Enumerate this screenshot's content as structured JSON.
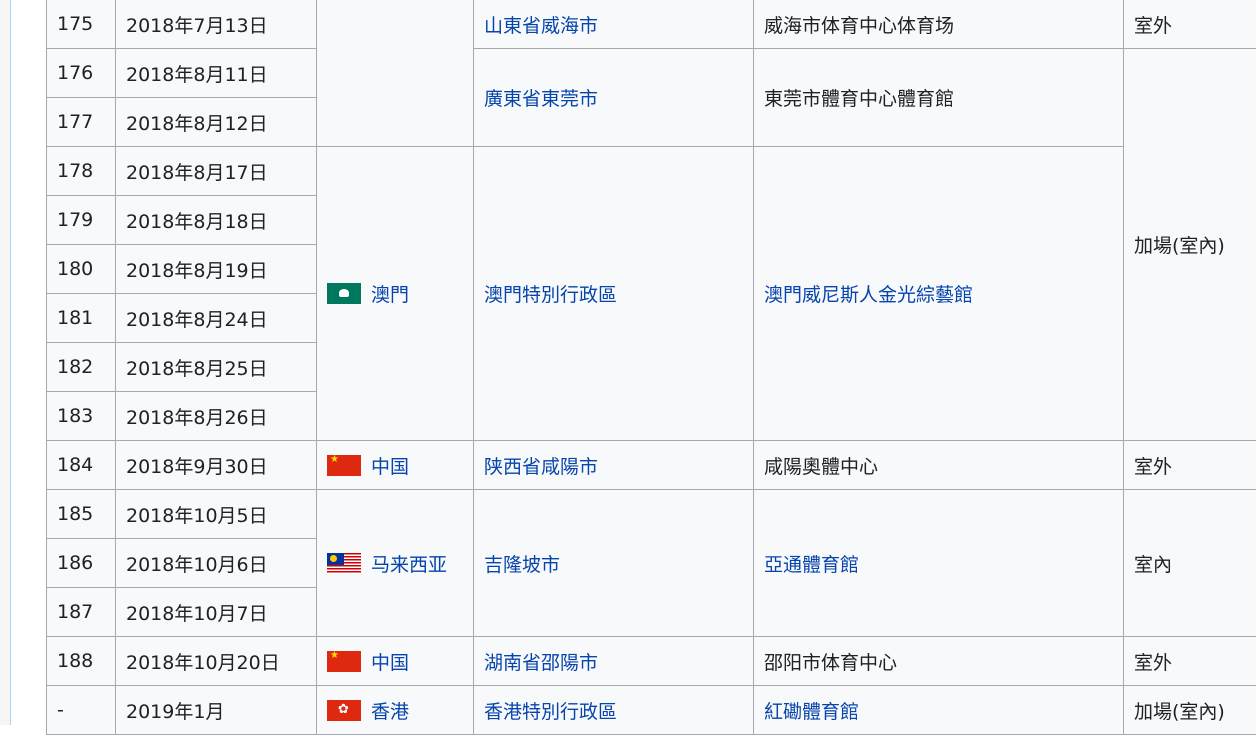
{
  "rows": [
    {
      "num": "175",
      "date": "2018年7月13日",
      "region": "",
      "city": "山東省威海市",
      "venue": "威海市体育中心体育场",
      "type": "室外"
    },
    {
      "num": "176",
      "date": "2018年8月11日",
      "region": "",
      "city": "廣東省東莞市",
      "venue": "東莞市體育中心體育館",
      "type": "加場(室內)"
    },
    {
      "num": "177",
      "date": "2018年8月12日"
    },
    {
      "num": "178",
      "date": "2018年8月17日",
      "region": "澳門",
      "city": "澳門特別行政區",
      "venue": "澳門威尼斯人金光綜藝館"
    },
    {
      "num": "179",
      "date": "2018年8月18日"
    },
    {
      "num": "180",
      "date": "2018年8月19日"
    },
    {
      "num": "181",
      "date": "2018年8月24日"
    },
    {
      "num": "182",
      "date": "2018年8月25日"
    },
    {
      "num": "183",
      "date": "2018年8月26日"
    },
    {
      "num": "184",
      "date": "2018年9月30日",
      "region": "中国",
      "city": "陕西省咸陽市",
      "venue": "咸陽奧體中心",
      "type": "室外"
    },
    {
      "num": "185",
      "date": "2018年10月5日",
      "region": "马来西亚",
      "city": "吉隆坡市",
      "venue": "亞通體育館",
      "type": "室內"
    },
    {
      "num": "186",
      "date": "2018年10月6日"
    },
    {
      "num": "187",
      "date": "2018年10月7日"
    },
    {
      "num": "188",
      "date": "2018年10月20日",
      "region": "中国",
      "city": "湖南省邵陽市",
      "venue": "邵阳市体育中心",
      "type": "室外"
    },
    {
      "num": "-",
      "date": "2019年1月",
      "region": "香港",
      "city": "香港特別行政區",
      "venue": "紅磡體育館",
      "type": "加場(室內)"
    }
  ],
  "flags": {
    "macau": "macau-flag-icon",
    "china": "china-flag-icon",
    "malaysia": "malaysia-flag-icon",
    "hongkong": "hongkong-flag-icon"
  },
  "colors": {
    "link": "#0645ad",
    "border": "#a2a9b1",
    "cell_bg": "#f8f9fa"
  }
}
